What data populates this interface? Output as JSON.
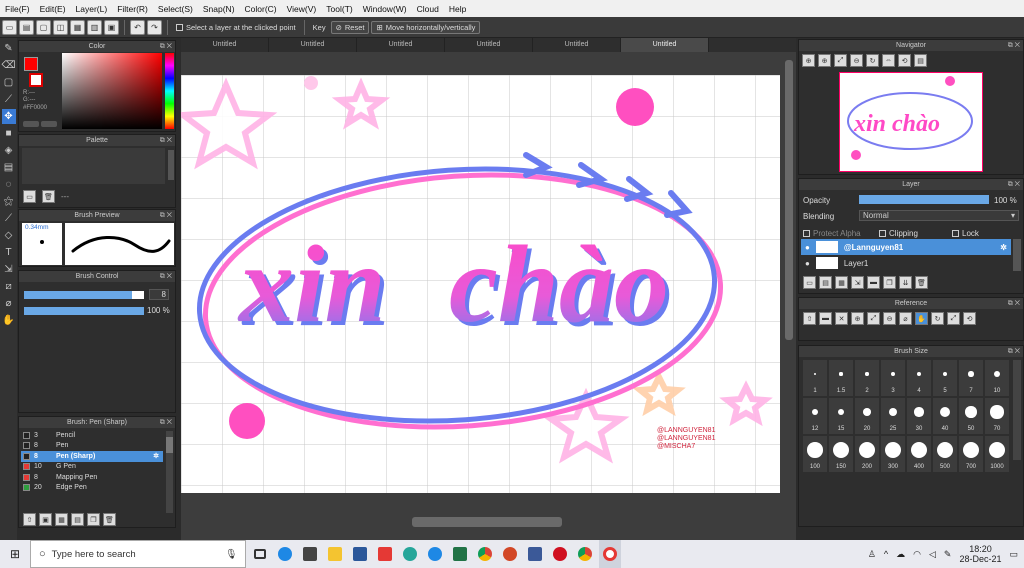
{
  "menubar": [
    "File(F)",
    "Edit(E)",
    "Layer(L)",
    "Filter(R)",
    "Select(S)",
    "Snap(N)",
    "Color(C)",
    "View(V)",
    "Tool(T)",
    "Window(W)",
    "Cloud",
    "Help"
  ],
  "toolbar": {
    "select_layer_label": "Select a layer at the clicked point",
    "key_label": "Key",
    "reset_label": "Reset",
    "move_label": "Move horizontally/vertically"
  },
  "tabs": [
    "Untitled",
    "Untitled",
    "Untitled",
    "Untitled",
    "Untitled",
    "Untitled"
  ],
  "color_panel": {
    "title": "Color",
    "r": "R:---",
    "g": "G:---",
    "hex": "#FF0000",
    "primary": "#ff0000"
  },
  "palette_panel": {
    "title": "Palette",
    "dash": "---"
  },
  "brush_preview": {
    "title": "Brush Preview",
    "size": "0.34mm"
  },
  "brush_control": {
    "title": "Brush Control",
    "size_value": "8",
    "opacity_value": "100 %",
    "opacity_fraction": 1.0,
    "size_fraction": 0.9
  },
  "brush_list": {
    "title": "Brush: Pen (Sharp)",
    "items": [
      {
        "size": "3",
        "name": "Pencil",
        "color": "#222222"
      },
      {
        "size": "8",
        "name": "Pen",
        "color": "#222222"
      },
      {
        "size": "8",
        "name": "Pen (Sharp)",
        "color": "#222222",
        "selected": true
      },
      {
        "size": "10",
        "name": "G Pen",
        "color": "#e53935"
      },
      {
        "size": "8",
        "name": "Mapping Pen",
        "color": "#e53935"
      },
      {
        "size": "20",
        "name": "Edge Pen",
        "color": "#2e9e3e"
      }
    ]
  },
  "artwork": {
    "word1": "xin",
    "word2": "chào",
    "credit1": "@LANNGUYEN81",
    "credit2": "@LANNGUYEN81",
    "credit3": "@MISCHA7"
  },
  "navigator": {
    "title": "Navigator",
    "mini_text": "xin chào"
  },
  "layer_panel": {
    "title": "Layer",
    "opacity_label": "Opacity",
    "opacity_value": "100 %",
    "opacity_fraction": 1.0,
    "blending_label": "Blending",
    "blending_value": "Normal",
    "protect_alpha": "Protect Alpha",
    "clipping": "Clipping",
    "lock": "Lock",
    "layers": [
      "@Lannguyen81",
      "Layer1"
    ]
  },
  "reference": {
    "title": "Reference"
  },
  "brush_size": {
    "title": "Brush Size",
    "sizes": [
      "1",
      "1.5",
      "2",
      "3",
      "4",
      "5",
      "7",
      "10",
      "12",
      "15",
      "20",
      "25",
      "30",
      "40",
      "50",
      "70",
      "100",
      "150",
      "200",
      "300",
      "400",
      "500",
      "700",
      "1000"
    ]
  },
  "taskbar": {
    "search_placeholder": "Type here to search",
    "time": "18:20",
    "date": "28-Dec-21"
  },
  "colors": {
    "accent": "#3a7bd5",
    "pink": "#ff4fc0",
    "blue": "#6a7cf0"
  }
}
